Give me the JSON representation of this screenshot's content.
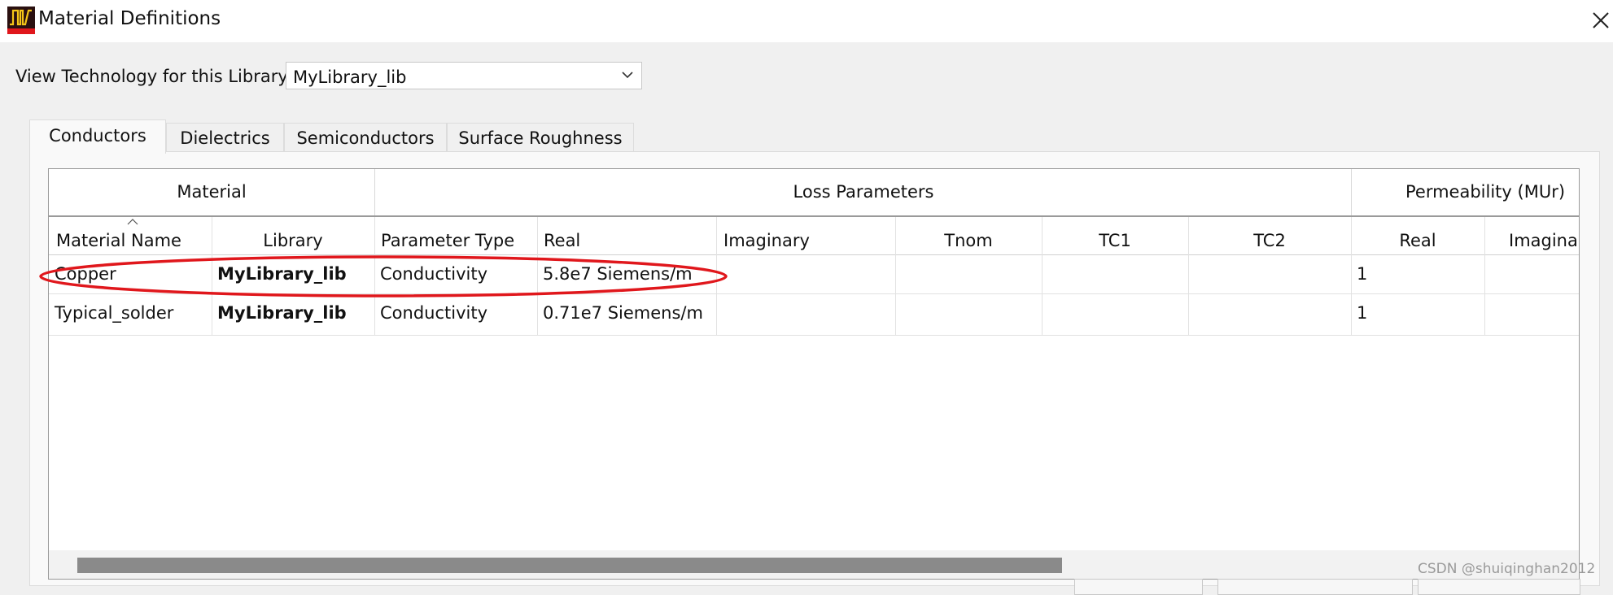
{
  "window": {
    "title": "Material Definitions",
    "app_icon": "app-icon",
    "close_icon": "close-icon"
  },
  "library_selector": {
    "label": "View Technology for this Library:",
    "selected": "MyLibrary_lib"
  },
  "tabs": [
    {
      "label": "Conductors",
      "active": true
    },
    {
      "label": "Dielectrics",
      "active": false
    },
    {
      "label": "Semiconductors",
      "active": false
    },
    {
      "label": "Surface Roughness",
      "active": false
    }
  ],
  "table": {
    "groups": [
      "Material",
      "Loss Parameters",
      "Permeability (MUr)"
    ],
    "columns": [
      "Material Name",
      "Library",
      "Parameter Type",
      "Real",
      "Imaginary",
      "Tnom",
      "TC1",
      "TC2",
      "Real",
      "Imagina"
    ],
    "sort_icon": "sort-ascending-icon",
    "rows": [
      [
        "Copper",
        "MyLibrary_lib",
        "Conductivity",
        "5.8e7 Siemens/m",
        "",
        "",
        "",
        "",
        "1",
        ""
      ],
      [
        "Typical_solder",
        "MyLibrary_lib",
        "Conductivity",
        "0.71e7 Siemens/m",
        "",
        "",
        "",
        "",
        "1",
        ""
      ]
    ],
    "highlighted_row": 0,
    "highlight_color": "#e0171c"
  },
  "watermark": "CSDN @shuiqinghan2012"
}
